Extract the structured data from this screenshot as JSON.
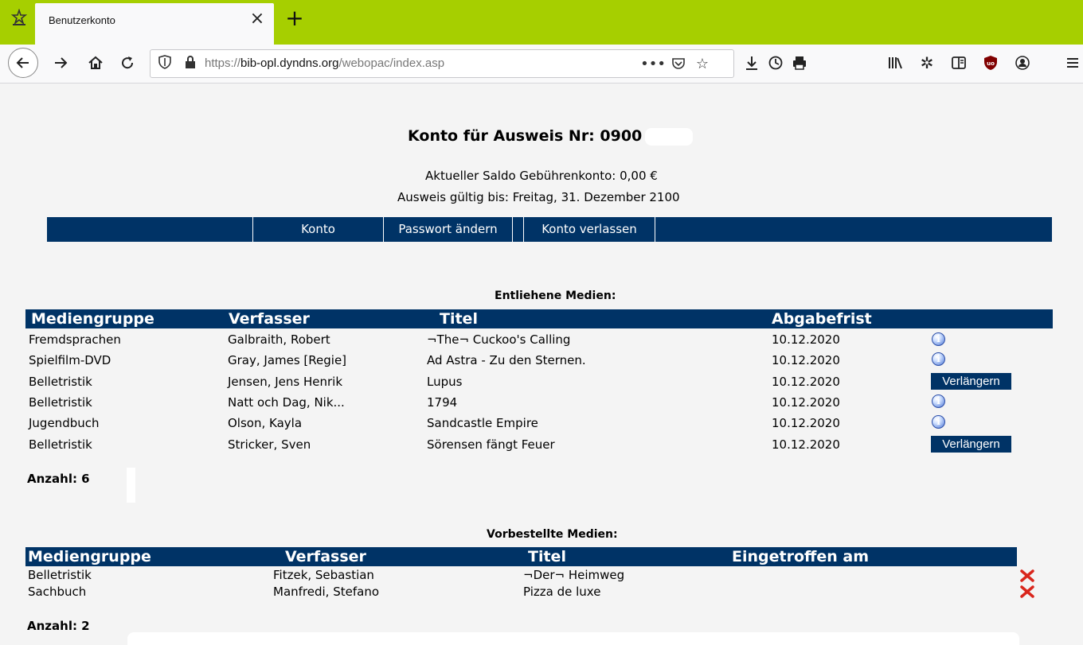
{
  "browser": {
    "tab_title": "Benutzerkonto",
    "url_prefix": "https://",
    "url_domain": "bib-opl.dyndns.org",
    "url_path": "/webopac/index.asp"
  },
  "account": {
    "title": "Konto für Ausweis Nr:  0900",
    "balance": "Aktueller Saldo Gebührenkonto:   0,00 €",
    "valid_until": "Ausweis gültig bis:  Freitag, 31. Dezember 2100"
  },
  "menu": {
    "konto": "Konto",
    "passwort": "Passwort ändern",
    "verlassen": "Konto verlassen"
  },
  "loans": {
    "title": "Entliehene Medien:",
    "headers": [
      "Mediengruppe",
      "Verfasser",
      "Titel",
      "Abgabefrist"
    ],
    "rows": [
      {
        "group": "Fremdsprachen",
        "author": "Galbraith, Robert",
        "title": "¬The¬ Cuckoo's Calling",
        "due": "10.12.2020",
        "action": "info"
      },
      {
        "group": "Spielfilm-DVD",
        "author": "Gray, James [Regie]",
        "title": "Ad Astra - Zu den Sternen.",
        "due": "10.12.2020",
        "action": "info"
      },
      {
        "group": "Belletristik",
        "author": "Jensen, Jens Henrik",
        "title": "Lupus",
        "due": "10.12.2020",
        "action": "Verlängern"
      },
      {
        "group": "Belletristik",
        "author": "Natt och Dag, Nik...",
        "title": "1794",
        "due": "10.12.2020",
        "action": "info"
      },
      {
        "group": "Jugendbuch",
        "author": "Olson, Kayla",
        "title": "Sandcastle Empire",
        "due": "10.12.2020",
        "action": "info"
      },
      {
        "group": "Belletristik",
        "author": "Stricker, Sven",
        "title": "Sörensen fängt Feuer",
        "due": "10.12.2020",
        "action": "Verlängern"
      }
    ],
    "count": "Anzahl: 6"
  },
  "reservations": {
    "title": "Vorbestellte Medien:",
    "headers": [
      "Mediengruppe",
      "Verfasser",
      "Titel",
      "Eingetroffen am"
    ],
    "rows": [
      {
        "group": "Belletristik",
        "author": "Fitzek, Sebastian",
        "title": "¬Der¬ Heimweg",
        "arrived": ""
      },
      {
        "group": "Sachbuch",
        "author": "Manfredi, Stefano",
        "title": "Pizza de luxe",
        "arrived": ""
      }
    ],
    "count": "Anzahl: 2"
  },
  "icons": {
    "info": "i",
    "delete_color": "#d9261c"
  },
  "colors": {
    "browser_accent": "#a6cf00",
    "navy": "#003366"
  }
}
